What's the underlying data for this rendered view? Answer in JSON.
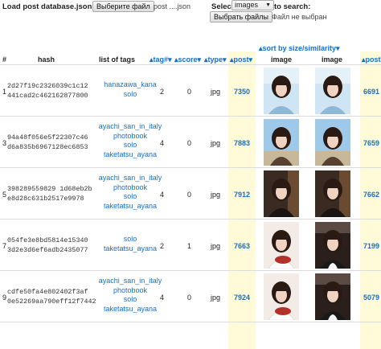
{
  "top": {
    "load_label": "Load post database.json:",
    "file_button": "Выберите файл",
    "file_name": "post ....json",
    "select_label": "Select",
    "select_value": "images",
    "to_search_label": "to search:",
    "file_button2": "Выбрать файлы",
    "file_status2": "Файл не выбран"
  },
  "headers": {
    "num": "#",
    "hash": "hash",
    "tags": "list of tags",
    "tag_count": "▴tag#▾",
    "score": "▴score▾",
    "type": "▴type▾",
    "post": "▴post▾",
    "sort_by": "▴sort by size/similarity▾",
    "image1": "image",
    "image2": "image",
    "post2": "▴post"
  },
  "rows": [
    {
      "num": "1",
      "hash1": "2d27f19c2326039c1c12",
      "hash2": "441cad2c462162877800",
      "tags": [
        "hanazawa_kana",
        "solo"
      ],
      "tag_count": "2",
      "score": "0",
      "type": "jpg",
      "post": "7350",
      "post2": "6691",
      "img1": "portrait-blue",
      "img2": "portrait-blue"
    },
    {
      "num": "3",
      "hash1": "94a48f056e5f22307c46",
      "hash2": "d6a835b6967128ec6853",
      "tags": [
        "ayachi_san_in_italy",
        "photobook",
        "solo",
        "taketatsu_ayana"
      ],
      "tag_count": "4",
      "score": "0",
      "type": "jpg",
      "post": "7883",
      "post2": "7659",
      "img1": "outdoor-sky",
      "img2": "outdoor-sky"
    },
    {
      "num": "5",
      "hash1": "398289559829 1d68eb2b",
      "hash2": "e8d28c631b2517e9978",
      "tags": [
        "ayachi_san_in_italy",
        "photobook",
        "solo",
        "taketatsu_ayana"
      ],
      "tag_count": "4",
      "score": "0",
      "type": "jpg",
      "post": "7912",
      "post2": "7662",
      "img1": "dark-room",
      "img2": "dark-room"
    },
    {
      "num": "7",
      "hash1": "054fe3e8bd5814e15340",
      "hash2": "3d2e3d6ef6adb2435077",
      "tags": [
        "solo",
        "taketatsu_ayana"
      ],
      "tag_count": "2",
      "score": "1",
      "type": "jpg",
      "post": "7663",
      "post2": "7199",
      "img1": "maid-cake",
      "img2": "maid-dark"
    },
    {
      "num": "9",
      "hash1": "cdfe50fa4e802402f3af",
      "hash2": "0e52269aa790eff12f7442",
      "tags": [
        "ayachi_san_in_italy",
        "photobook",
        "solo",
        "taketatsu_ayana"
      ],
      "tag_count": "4",
      "score": "0",
      "type": "jpg",
      "post": "7924",
      "post2": "5079",
      "img1": "maid-cake",
      "img2": "maid-dark"
    }
  ],
  "colors": {
    "link": "#1a6fc4",
    "post_highlight": "#fffbd8"
  }
}
